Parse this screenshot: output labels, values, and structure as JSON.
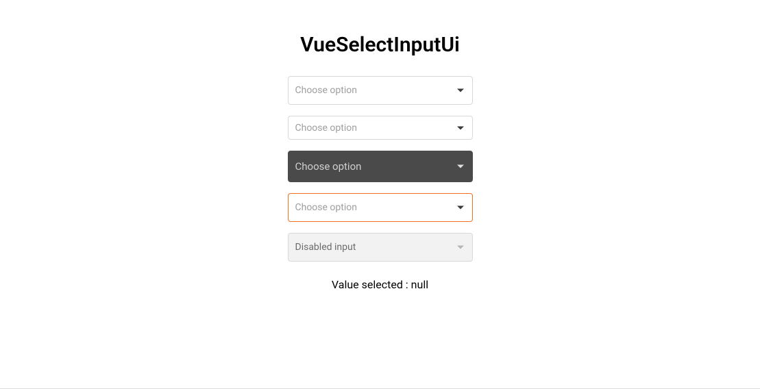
{
  "title": "VueSelectInputUi",
  "selects": [
    {
      "placeholder": "Choose option"
    },
    {
      "placeholder": "Choose option"
    },
    {
      "placeholder": "Choose option"
    },
    {
      "placeholder": "Choose option"
    },
    {
      "placeholder": "Disabled input"
    }
  ],
  "status": {
    "label": "Value selected : ",
    "value": "null"
  }
}
